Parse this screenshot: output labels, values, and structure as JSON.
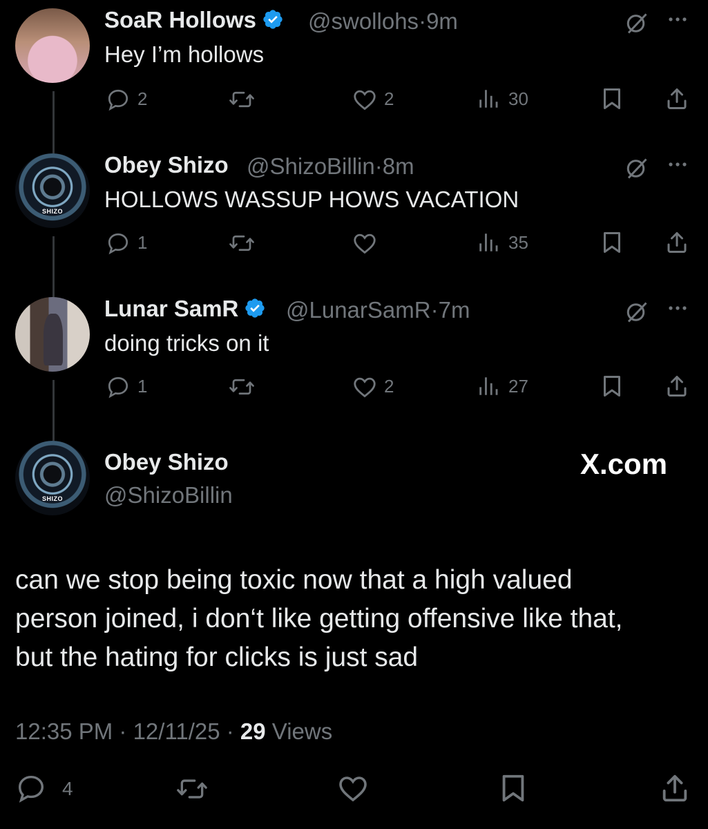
{
  "colors": {
    "background": "#000000",
    "text": "#e7e9ea",
    "muted": "#71767b",
    "verified": "#1d9bf0"
  },
  "watermark": "X.com",
  "replies": [
    {
      "name": "SoaR Hollows",
      "verified": true,
      "handle": "@swollohs",
      "sep": "·",
      "time": "9m",
      "text": "Hey I’m hollows",
      "reply_count": "2",
      "like_count": "2",
      "view_count": "30"
    },
    {
      "name": "Obey Shizo",
      "verified": false,
      "handle": "@ShizoBillin",
      "sep": "·",
      "time": "8m",
      "text": "HOLLOWS WASSUP HOWS VACATION",
      "reply_count": "1",
      "like_count": "",
      "view_count": "35",
      "avatar_tag": "SHIZO"
    },
    {
      "name": "Lunar SamR",
      "verified": true,
      "handle": "@LunarSamR",
      "sep": "·",
      "time": "7m",
      "text": "doing tricks on it",
      "reply_count": "1",
      "like_count": "2",
      "view_count": "27"
    }
  ],
  "main_post": {
    "name": "Obey Shizo",
    "handle": "@ShizoBillin",
    "avatar_tag": "SHIZO",
    "text_lines": [
      "can we stop being toxic now that a high valued",
      "person joined, i don‘t like getting offensive like that,",
      "but the hating for clicks is just sad"
    ],
    "time": "12:35 PM",
    "sep1": " · ",
    "date": "12/11/25",
    "sep2": " · ",
    "views": "29",
    "views_label": " Views",
    "reply_count": "4"
  },
  "icons": [
    "reply-icon",
    "retweet-icon",
    "like-icon",
    "views-icon",
    "bookmark-icon",
    "share-icon",
    "grok-icon",
    "more-icon",
    "verified-icon"
  ]
}
